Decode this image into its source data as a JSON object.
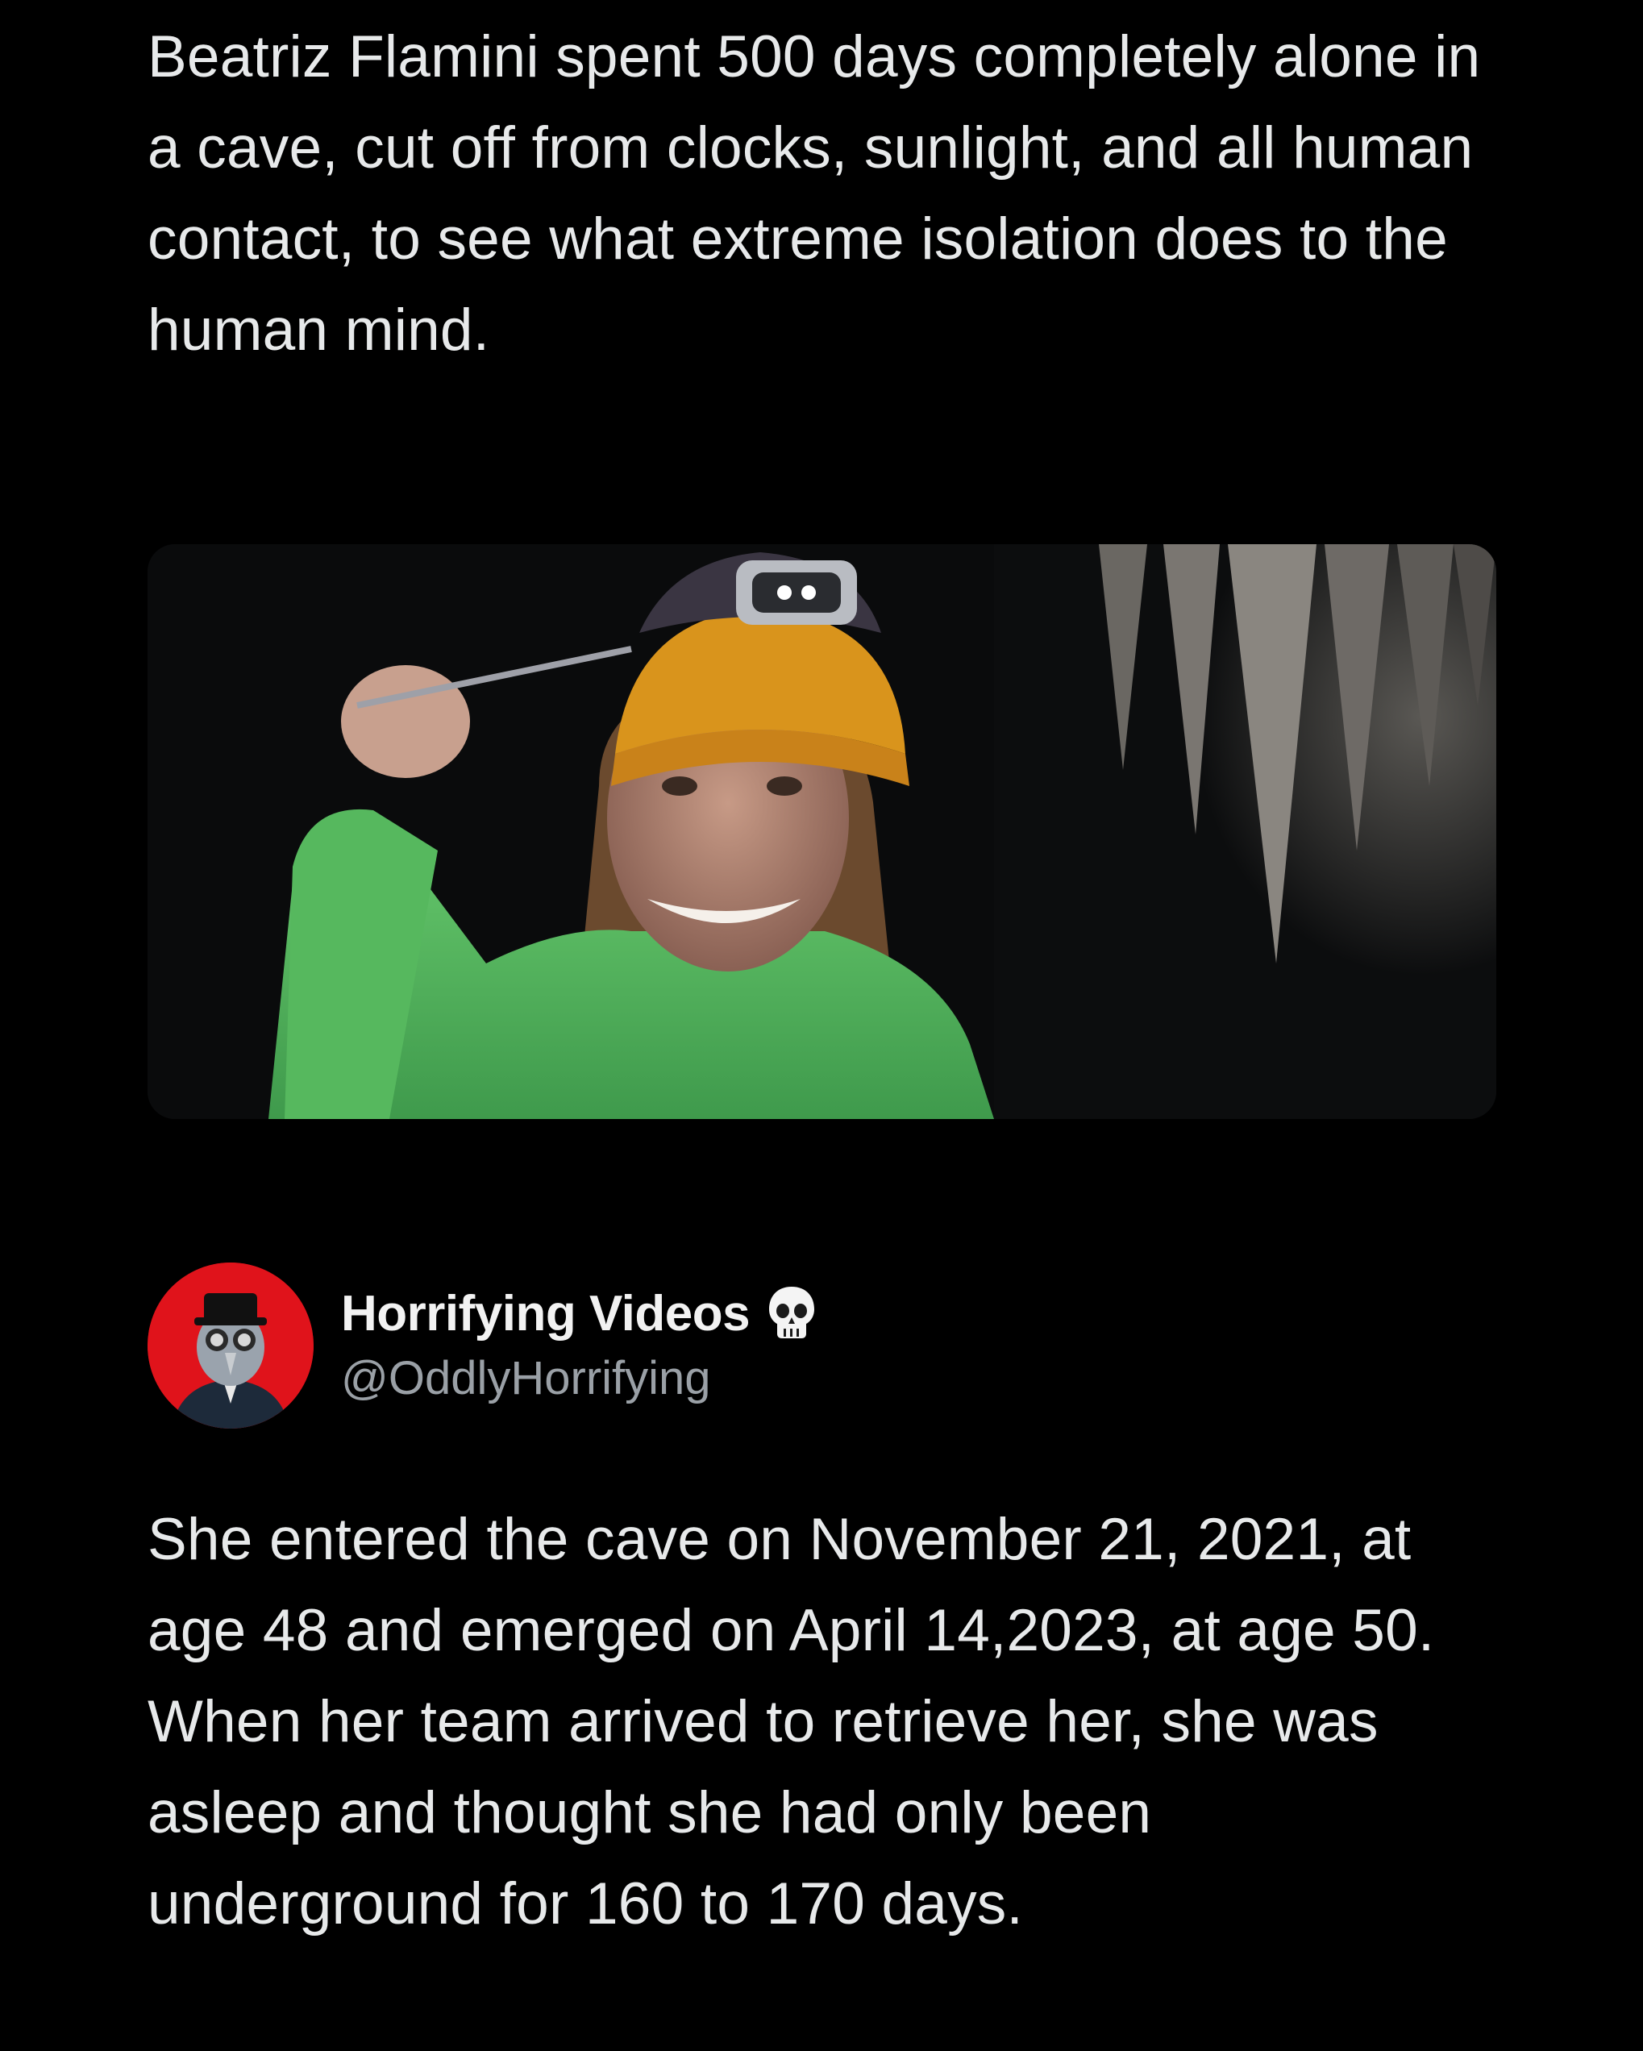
{
  "post": {
    "intro_text": "Beatriz Flamini spent 500 days completely alone in a cave, cut off from clocks, sunlight, and all human contact, to see what extreme isolation does to the human mind.",
    "media": {
      "icon": "photo-cave-woman-headlamp"
    }
  },
  "author": {
    "display_name": "Horrifying Videos",
    "handle": "@OddlyHorrifying",
    "badge_icon": "skull-icon",
    "avatar_icon": "plague-doctor-avatar",
    "avatar_color": "#e0131b"
  },
  "reply": {
    "text": "She entered the cave on November 21, 2021, at age 48 and emerged on April 14,2023, at age 50. When her team arrived to retrieve her, she was asleep and thought she had only been underground for 160 to 170 days."
  }
}
